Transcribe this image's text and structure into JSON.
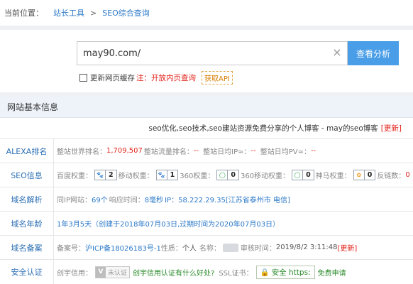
{
  "breadcrumb": {
    "lead": "当前位置：",
    "link": "站长工具",
    "sep": ">",
    "current": "SEO综合查询"
  },
  "search": {
    "value": "may90.com/",
    "clear_icon": "×",
    "button": "查看分析",
    "option_label": "更新网页缓存",
    "option_note": "注：开放内页查询",
    "api_label": "获取API"
  },
  "info": {
    "header": "网站基本信息",
    "site_title": "seo优化,seo技术,seo建站资源免费分享的个人博客 - may的seo博客",
    "refresh": "[更新]",
    "rows": {
      "alexa": {
        "label": "ALEXA排名",
        "world_rank_label": "整站世界排名：",
        "world_rank": "1,709,507",
        "traffic_rank_label": "整站流量排名：",
        "traffic_rank": "--",
        "daily_ip_label": "整站日均IP≈：",
        "daily_ip": "--",
        "daily_pv_label": "整站日均PV≈：",
        "daily_pv": "--"
      },
      "seo": {
        "label": "SEO信息",
        "baidu_label": "百度权重：",
        "baidu": "2",
        "mobile_label": "移动权重：",
        "mobile": "1",
        "s360_label": "360权重：",
        "s360": "0",
        "s360m_label": "360移动权重：",
        "s360m": "0",
        "shenma_label": "神马权重：",
        "shenma": "0",
        "backlink_label": "反链数：",
        "backlink": "0"
      },
      "domain": {
        "label": "域名解析",
        "same_ip_label": "同IP网站：",
        "same_ip": "69个",
        "resp_label": "响应时间：",
        "resp": "8毫秒",
        "ip_label": "IP：",
        "ip": "58.222.29.35[江苏省泰州市 电信]"
      },
      "age": {
        "label": "域名年龄",
        "value": "1年3月5天（创建于2018年07月03日,过期时间为2020年07月03日）"
      },
      "icp": {
        "label": "域名备案",
        "no_label": "备案号：",
        "no": "沪ICP备18026183号-1",
        "nature_label": "性质：",
        "name_label": "个人",
        "owner_label": "名称：",
        "check_label": "审核时间：",
        "check_time": "2019/8/2 3:11:48",
        "refresh": "[更新]"
      },
      "security": {
        "label": "安全认证",
        "trust_label": "创宇信用：",
        "trust_badge_v": "V",
        "trust_badge": "未认证",
        "trust_link": "创宇信用认证有什么好处?",
        "ssl_label": "SSL证书：",
        "ssl_btn": "安全 https:",
        "ssl_apply": "免费申请"
      }
    }
  },
  "colors": {
    "accent": "#4a9ee8",
    "link": "#2c79c8",
    "alert": "#e2231a",
    "header_bg": "#eef3fa"
  },
  "icons": {
    "clear": "close-icon",
    "checkbox": "checkbox-icon",
    "baidu": "baidu-paw-icon",
    "mobile": "baidu-mobile-icon",
    "s360": "360-icon",
    "s360m": "360-mobile-icon",
    "shenma": "shenma-icon",
    "lock": "lock-icon"
  }
}
